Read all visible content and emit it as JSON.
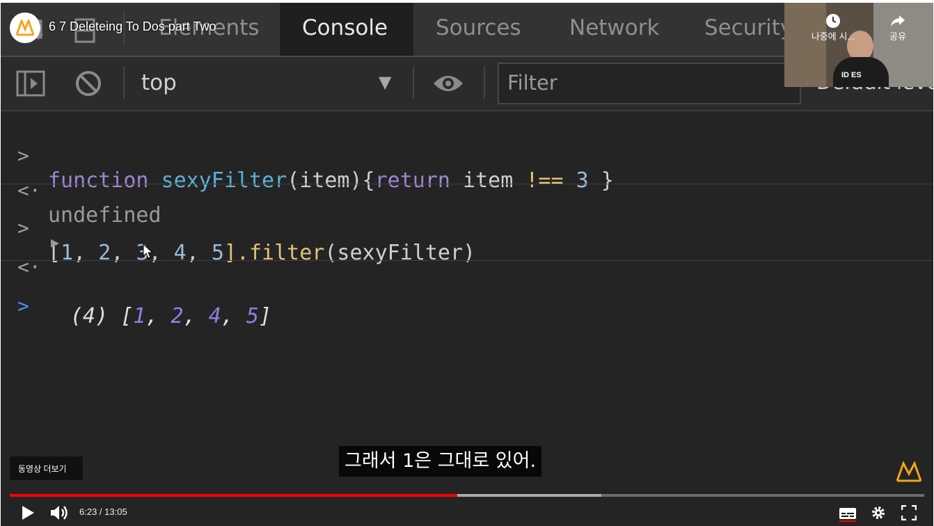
{
  "video": {
    "title": "6 7 Deleteing To Dos part Two",
    "channel_logo": "m-logo-icon",
    "watch_later_label": "나중에 시...",
    "share_label": "공유",
    "more_videos_label": "동영상 더보기",
    "subtitle": "그래서 1은 그대로 있어.",
    "time": "6:23 / 13:05",
    "progress_fraction": 0.489,
    "buffered_fraction": 0.647,
    "webcam_caption": "ID  ES"
  },
  "devtools": {
    "tabs": [
      "Elements",
      "Console",
      "Sources",
      "Network",
      "Security"
    ],
    "active_tab": "Console",
    "context_label": "top",
    "filter_placeholder": "Filter",
    "levels_label": "Default leve"
  },
  "console": {
    "line1_keyword": "function",
    "line1_name": "sexyFilter",
    "line1_param": "(item){",
    "line1_return": "return",
    "line1_item": " item ",
    "line1_op": "!==",
    "line1_num": " 3 ",
    "line1_close": "}",
    "line2_result": "undefined",
    "line3_open": "[",
    "line3_values": [
      "1",
      "2",
      "3",
      "4",
      "5"
    ],
    "line3_method": "].filter",
    "line3_arg": "(sexyFilter)",
    "line4_count": "(4)",
    "line4_values": [
      "1",
      "2",
      "4",
      "5"
    ]
  },
  "colors": {
    "accent_red": "#ff0000",
    "logo_orange": "#f4a41f"
  }
}
